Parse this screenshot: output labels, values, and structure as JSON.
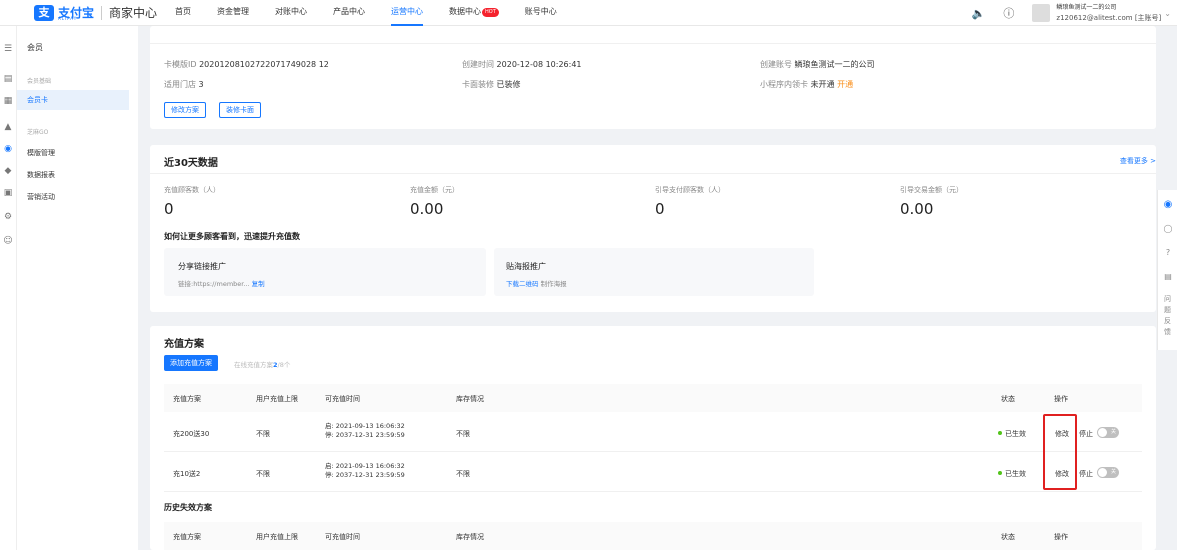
{
  "topbar": {
    "logo_text": "支付宝",
    "logo_sub": "ALIPAY",
    "product": "商家中心",
    "nav": [
      {
        "label": "首页"
      },
      {
        "label": "资金管理"
      },
      {
        "label": "对账中心"
      },
      {
        "label": "产品中心"
      },
      {
        "label": "运营中心",
        "active": true
      },
      {
        "label": "数据中心",
        "badge": "HOT"
      },
      {
        "label": "账号中心"
      }
    ],
    "account_name": "鳞琅鱼测试一二的公司",
    "account_email": "z120612@alitest.com [主账号]"
  },
  "sidebar": {
    "title": "会员",
    "groups": [
      {
        "label": "会员基础",
        "items": [
          {
            "label": "会员卡",
            "active": true
          }
        ]
      },
      {
        "label": "芝麻GO",
        "items": [
          {
            "label": "模版管理"
          },
          {
            "label": "数据报表"
          },
          {
            "label": "营销活动"
          }
        ]
      }
    ]
  },
  "card_info": {
    "template_id_label": "卡模版ID",
    "template_id": "20201208102722071749028 12",
    "stores_label": "适用门店",
    "stores": "3",
    "created_time_label": "创建时间",
    "created_time": "2020-12-08 10:26:41",
    "decoration_label": "卡面装修",
    "decoration": "已装修",
    "creator_label": "创建账号",
    "creator": "鳞琅鱼测试一二的公司",
    "miniapp_label": "小程序内领卡",
    "miniapp_status": "未开通",
    "miniapp_action": "开通",
    "btn_edit_plan": "修改方案",
    "btn_decorate": "装修卡面"
  },
  "stats": {
    "title": "近30天数据",
    "more": "查看更多 >",
    "metrics": [
      {
        "label": "充值顾客数（人）",
        "value": "0"
      },
      {
        "label": "充值金额（元）",
        "value": "0.00"
      },
      {
        "label": "引导支付顾客数（人）",
        "value": "0"
      },
      {
        "label": "引导交易金额（元）",
        "value": "0.00"
      }
    ],
    "tip": "如何让更多顾客看到，迅速提升充值数",
    "share": {
      "title": "分享链接推广",
      "link_label": "链接:https://member...",
      "copy": "复制"
    },
    "poster": {
      "title": "贴海报推广",
      "download": "下载二维码",
      "make": "制作海报"
    }
  },
  "recharge": {
    "title": "充值方案",
    "add_button": "添加充值方案",
    "online_count_prefix": "在线充值方案",
    "online_count": "2",
    "online_count_suffix": "/8个",
    "headers": [
      "充值方案",
      "用户充值上限",
      "可充值时间",
      "库存情况",
      "状态",
      "操作"
    ],
    "rows": [
      {
        "name": "充200送30",
        "limit": "不限",
        "start": "启: 2021-09-13 16:06:32",
        "end": "停: 2037-12-31 23:59:59",
        "stock": "不限",
        "status": "已生效",
        "edit": "修改",
        "stop": "停止",
        "toggle": "关"
      },
      {
        "name": "充10送2",
        "limit": "不限",
        "start": "启: 2021-09-13 16:06:32",
        "end": "停: 2037-12-31 23:59:59",
        "stock": "不限",
        "status": "已生效",
        "edit": "修改",
        "stop": "停止",
        "toggle": "关"
      }
    ],
    "history_title": "历史失效方案"
  },
  "floatbar": {
    "feedback": "问题反馈"
  },
  "colors": {
    "accent": "#1677ff",
    "success": "#52c41a",
    "warning": "#fa8c16",
    "highlight": "#e02020"
  }
}
